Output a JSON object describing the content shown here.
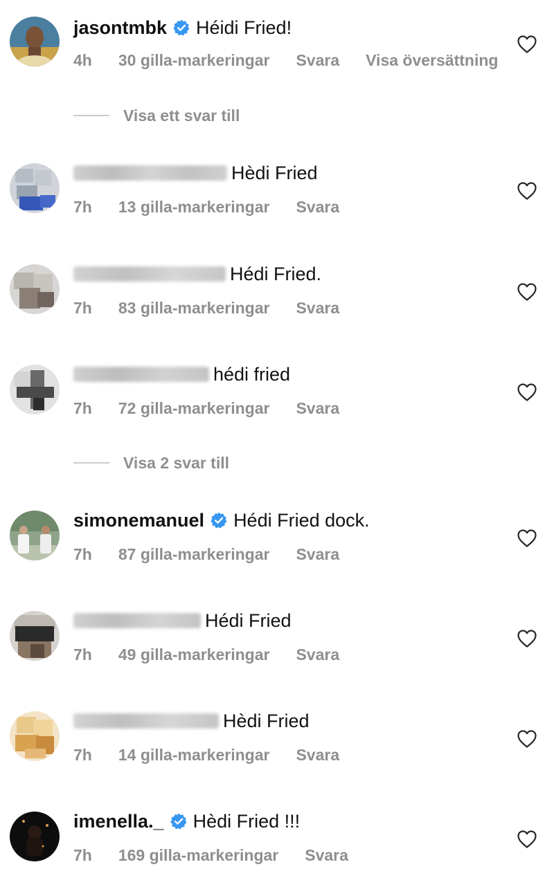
{
  "comments": [
    {
      "username": "jasontmbk",
      "verified": true,
      "text": "Héidi Fried!",
      "time": "4h",
      "likes": "30 gilla-markeringar",
      "reply": "Svara",
      "translate": "Visa översättning"
    },
    {
      "username": "",
      "verified": false,
      "text": "Hèdi Fried",
      "time": "7h",
      "likes": "13 gilla-markeringar",
      "reply": "Svara"
    },
    {
      "username": "",
      "verified": false,
      "text": "Hédi Fried.",
      "time": "7h",
      "likes": "83 gilla-markeringar",
      "reply": "Svara"
    },
    {
      "username": "",
      "verified": false,
      "text": "hédi fried",
      "time": "7h",
      "likes": "72 gilla-markeringar",
      "reply": "Svara"
    },
    {
      "username": "simonemanuel",
      "verified": true,
      "text": "Hédi Fried dock.",
      "time": "7h",
      "likes": "87 gilla-markeringar",
      "reply": "Svara"
    },
    {
      "username": "",
      "verified": false,
      "text": "Hédi Fried",
      "time": "7h",
      "likes": "49 gilla-markeringar",
      "reply": "Svara"
    },
    {
      "username": "",
      "verified": false,
      "text": "Hèdi Fried",
      "time": "7h",
      "likes": "14 gilla-markeringar",
      "reply": "Svara"
    },
    {
      "username": "imenella._",
      "verified": true,
      "text": "Hèdi Fried !!!",
      "time": "7h",
      "likes": "169 gilla-markeringar",
      "reply": "Svara"
    }
  ],
  "view_replies": [
    "Visa ett svar till",
    "Visa 2 svar till"
  ],
  "colors": {
    "text": "#111111",
    "meta": "#8e8e8e",
    "verified": "#3897f0",
    "divider": "#cccccc"
  },
  "icons": {
    "verified": "verified-badge-icon",
    "like": "heart-outline-icon"
  }
}
